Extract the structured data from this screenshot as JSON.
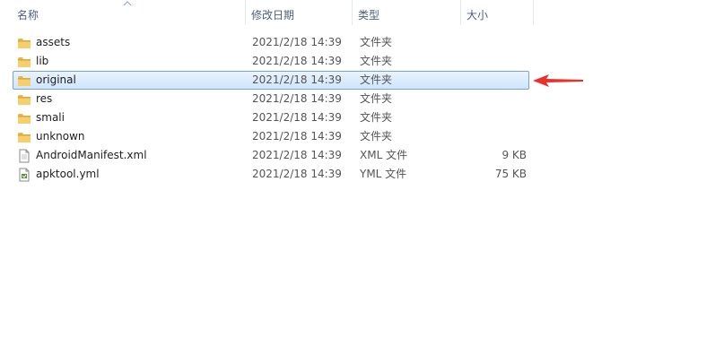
{
  "columns": {
    "name": "名称",
    "date": "修改日期",
    "type": "类型",
    "size": "大小"
  },
  "files": [
    {
      "name": "assets",
      "date": "2021/2/18 14:39",
      "type": "文件夹",
      "size": "",
      "icon": "folder-icon",
      "selected": false
    },
    {
      "name": "lib",
      "date": "2021/2/18 14:39",
      "type": "文件夹",
      "size": "",
      "icon": "folder-icon",
      "selected": false
    },
    {
      "name": "original",
      "date": "2021/2/18 14:39",
      "type": "文件夹",
      "size": "",
      "icon": "folder-icon",
      "selected": true
    },
    {
      "name": "res",
      "date": "2021/2/18 14:39",
      "type": "文件夹",
      "size": "",
      "icon": "folder-icon",
      "selected": false
    },
    {
      "name": "smali",
      "date": "2021/2/18 14:39",
      "type": "文件夹",
      "size": "",
      "icon": "folder-icon",
      "selected": false
    },
    {
      "name": "unknown",
      "date": "2021/2/18 14:39",
      "type": "文件夹",
      "size": "",
      "icon": "folder-icon",
      "selected": false
    },
    {
      "name": "AndroidManifest.xml",
      "date": "2021/2/18 14:39",
      "type": "XML 文件",
      "size": "9 KB",
      "icon": "xml-file-icon",
      "selected": false
    },
    {
      "name": "apktool.yml",
      "date": "2021/2/18 14:39",
      "type": "YML 文件",
      "size": "75 KB",
      "icon": "yml-file-icon",
      "selected": false
    }
  ],
  "colors": {
    "header_text": "#4c607a",
    "selection_border": "#7da2ce",
    "annotation_arrow": "#e8312b",
    "folder": "#e8b84a"
  },
  "annotation": {
    "icon": "red-arrow-icon"
  }
}
